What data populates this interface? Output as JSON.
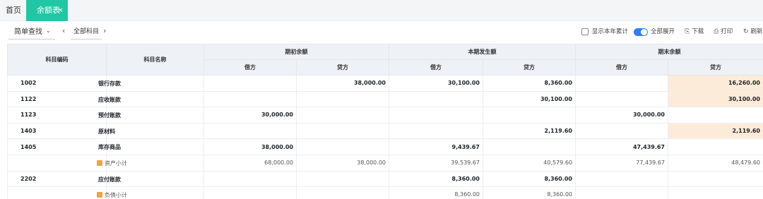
{
  "tabs": {
    "home_label": "首页",
    "active_label": "余额表",
    "close_glyph": "×"
  },
  "toolbar": {
    "query_type": "简单查找",
    "subject_filter": "全部科目",
    "show_year_total_label": "显示本年累计",
    "show_year_total_checked": false,
    "expand_all_label": "全部展开",
    "expand_all_on": true,
    "download_label": "下载",
    "print_label": "打印",
    "refresh_label": "刷新"
  },
  "table": {
    "headers": {
      "code": "科目编码",
      "name": "科目名称",
      "opening": "期初余额",
      "period": "本期发生额",
      "closing": "期末余额",
      "debit": "借方",
      "credit": "贷方"
    },
    "rows": [
      {
        "type": "account",
        "code": "1002",
        "name": "银行存款",
        "open_debit": "",
        "open_credit": "38,000.00",
        "period_debit": "30,100.00",
        "period_credit": "8,360.00",
        "close_debit": "",
        "close_credit": "16,260.00"
      },
      {
        "type": "account",
        "code": "1122",
        "name": "应收账款",
        "open_debit": "",
        "open_credit": "",
        "period_debit": "",
        "period_credit": "30,100.00",
        "close_debit": "",
        "close_credit": "30,100.00"
      },
      {
        "type": "account",
        "code": "1123",
        "name": "预付账款",
        "open_debit": "30,000.00",
        "open_credit": "",
        "period_debit": "",
        "period_credit": "",
        "close_debit": "30,000.00",
        "close_credit": ""
      },
      {
        "type": "account",
        "code": "1403",
        "name": "原材料",
        "open_debit": "",
        "open_credit": "",
        "period_debit": "",
        "period_credit": "2,119.60",
        "close_debit": "",
        "close_credit": "2,119.60"
      },
      {
        "type": "account",
        "code": "1405",
        "name": "库存商品",
        "open_debit": "38,000.00",
        "open_credit": "",
        "period_debit": "9,439.67",
        "period_credit": "",
        "close_debit": "47,439.67",
        "close_credit": ""
      },
      {
        "type": "subtotal",
        "label": "资产小计",
        "open_debit": "68,000.00",
        "open_credit": "38,000.00",
        "period_debit": "39,539.67",
        "period_credit": "40,579.60",
        "close_debit": "77,439.67",
        "close_credit": "48,479.60"
      },
      {
        "type": "account",
        "code": "2202",
        "name": "应付账款",
        "open_debit": "",
        "open_credit": "",
        "period_debit": "8,360.00",
        "period_credit": "8,360.00",
        "close_debit": "",
        "close_credit": ""
      },
      {
        "type": "subtotal",
        "label": "负债小计",
        "open_debit": "",
        "open_credit": "",
        "period_debit": "8,360.00",
        "period_credit": "8,360.00",
        "close_debit": "",
        "close_credit": ""
      }
    ]
  },
  "colors": {
    "accent_tab": "#21c7a5",
    "toggle_on": "#2f7ef5",
    "highlight_cell": "#fdebd9",
    "header_bg": "#eef1f6"
  }
}
